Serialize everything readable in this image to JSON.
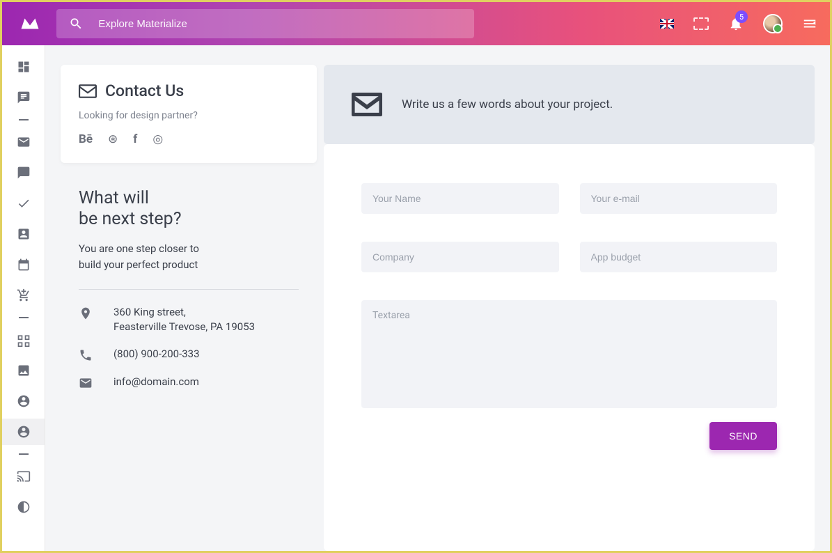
{
  "topbar": {
    "search_placeholder": "Explore Materialize",
    "notification_count": "5"
  },
  "page": {
    "title": "Contact Us",
    "subtitle": "Looking for design partner?"
  },
  "next_step": {
    "heading_line1": "What will",
    "heading_line2": "be next step?",
    "desc": "You are one step closer to build your perfect product"
  },
  "contact_info": {
    "address_line1": "360 King street,",
    "address_line2": "Feasterville Trevose, PA 19053",
    "phone": "(800) 900-200-333",
    "email": "info@domain.com"
  },
  "prompt": "Write us a few words about your project.",
  "form": {
    "name_placeholder": "Your Name",
    "email_placeholder": "Your e-mail",
    "company_placeholder": "Company",
    "budget_placeholder": "App budget",
    "textarea_placeholder": "Textarea",
    "send_label": "SEND"
  }
}
